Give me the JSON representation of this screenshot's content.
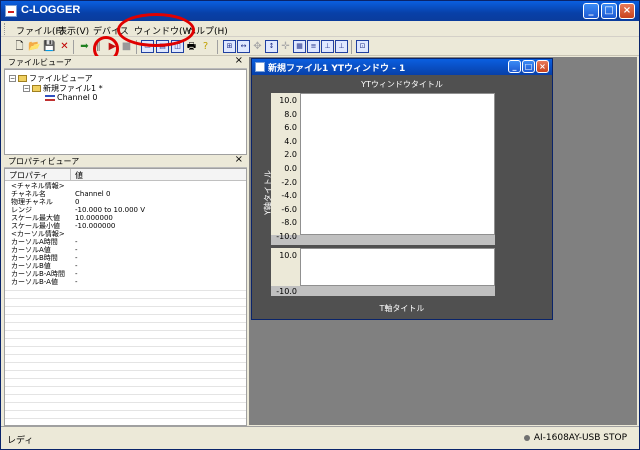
{
  "app": {
    "title": "C-LOGGER"
  },
  "menu": [
    {
      "label": "ファイル(F)"
    },
    {
      "label": "表示(V)"
    },
    {
      "label": "デバイス"
    },
    {
      "label": "ウィンドウ(W)"
    },
    {
      "label": "ヘルプ(H)"
    }
  ],
  "file_viewer": {
    "header": "ファイルビューア",
    "root": "ファイルビューア",
    "file": "新規ファイル1 *",
    "channel": "Channel 0"
  },
  "property_viewer": {
    "header": "プロパティビューア",
    "col_property": "プロパティ",
    "col_value": "値",
    "rows": [
      {
        "k": "<チャネル情報>",
        "v": ""
      },
      {
        "k": "チャネル名",
        "v": "Channel 0"
      },
      {
        "k": "物理チャネル",
        "v": "0"
      },
      {
        "k": "レンジ",
        "v": "-10.000 to 10.000 V"
      },
      {
        "k": "スケール最大値",
        "v": "10.000000"
      },
      {
        "k": "スケール最小値",
        "v": "-10.000000"
      },
      {
        "k": "<カーソル情報>",
        "v": ""
      },
      {
        "k": "カーソルA時間",
        "v": "-"
      },
      {
        "k": "カーソルA値",
        "v": "-"
      },
      {
        "k": "カーソルB時間",
        "v": "-"
      },
      {
        "k": "カーソルB値",
        "v": "-"
      },
      {
        "k": "カーソルB-A時間",
        "v": "-"
      },
      {
        "k": "カーソルB-A値",
        "v": "-"
      }
    ]
  },
  "yt_window": {
    "title": "新規ファイル1 YTウィンドウ - 1",
    "chart_title": "YTウィンドウタイトル",
    "y_axis_title": "Y軸タイトル",
    "x_axis_title": "T軸タイトル",
    "upper_ticks": [
      "10.0",
      "8.0",
      "6.0",
      "4.0",
      "2.0",
      "0.0",
      "-2.0",
      "-4.0",
      "-6.0",
      "-8.0",
      "-10.0"
    ],
    "lower_ticks": [
      "10.0",
      "-10.0"
    ]
  },
  "status": {
    "left": "レディ",
    "right": "AI-1608AY-USB STOP"
  },
  "annotation_color": "#e00000"
}
